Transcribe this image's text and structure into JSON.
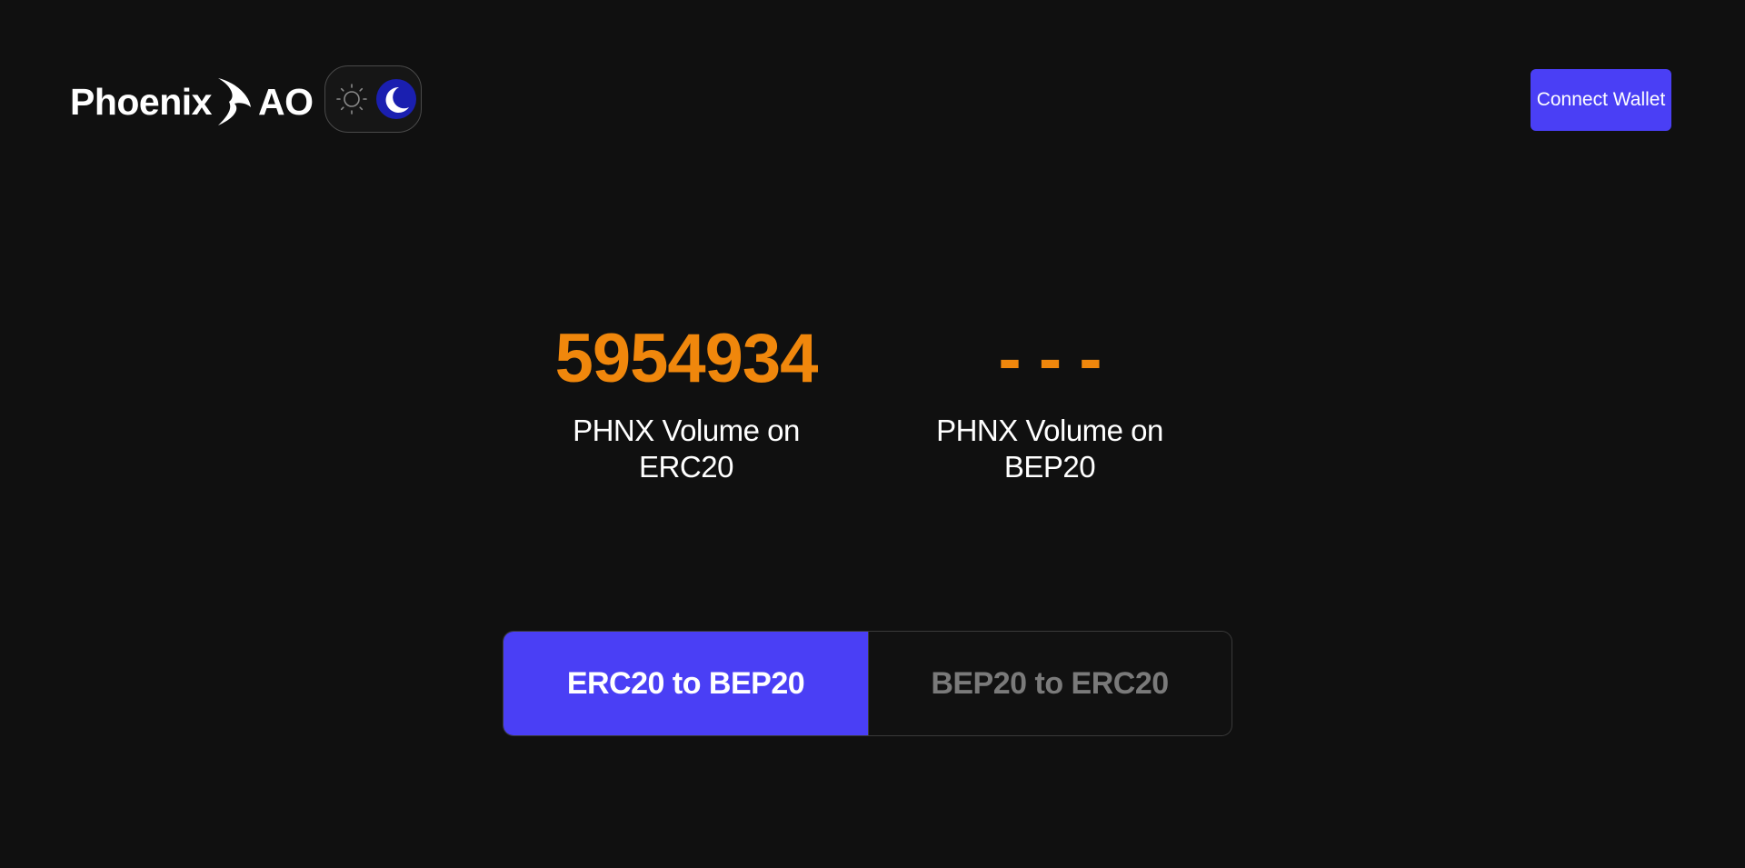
{
  "header": {
    "logo": {
      "text_left": "Phoenix",
      "text_right": "AO",
      "icon": "phoenix-wing-icon"
    },
    "theme_toggle": {
      "light_icon": "sun-icon",
      "dark_icon": "moon-icon",
      "selected": "dark"
    },
    "connect_wallet_label": "Connect Wallet"
  },
  "stats": {
    "erc20": {
      "value": "5954934",
      "label": "PHNX Volume on ERC20"
    },
    "bep20": {
      "value": "- - -",
      "label": "PHNX Volume on BEP20"
    }
  },
  "tabs": [
    {
      "label": "ERC20 to BEP20",
      "active": true
    },
    {
      "label": "BEP20 to ERC20",
      "active": false
    }
  ],
  "colors": {
    "background": "#101010",
    "accent": "#4a3ff5",
    "stat_value": "#f0870c",
    "moon_knob": "#1a1fb0",
    "inactive_text": "#7a7a7a"
  }
}
